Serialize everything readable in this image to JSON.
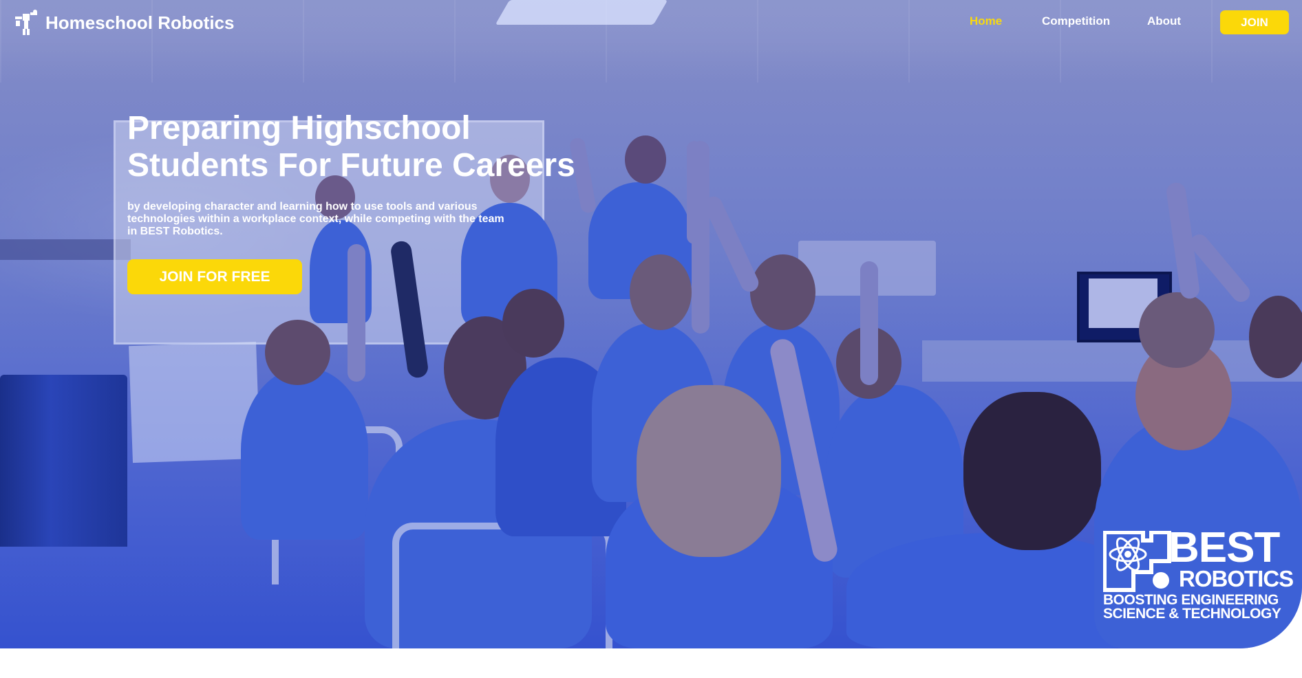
{
  "nav": {
    "brand": "Homeschool Robotics",
    "links": [
      {
        "label": "Home",
        "active": true
      },
      {
        "label": "Competition",
        "active": false
      },
      {
        "label": "About",
        "active": false
      }
    ],
    "join_label": "JOIN"
  },
  "hero": {
    "title_line1": "Preparing Highschool",
    "title_line2": "Students For Future Careers",
    "subtitle": "by developing character and learning how to use tools and various technologies within a workplace context, while competing with the team in BEST Robotics.",
    "cta_label": "JOIN FOR FREE",
    "overlay_color": "#3f5fd4",
    "accent_color": "#fbd809"
  },
  "best_logo": {
    "line1": "BEST",
    "line2": "ROBOTICS",
    "tagline1": "BOOSTING ENGINEERING",
    "tagline2": "SCIENCE & TECHNOLOGY"
  },
  "icons": {
    "brand": "robot-logo-icon",
    "best_mark": "atom-gear-icon"
  }
}
